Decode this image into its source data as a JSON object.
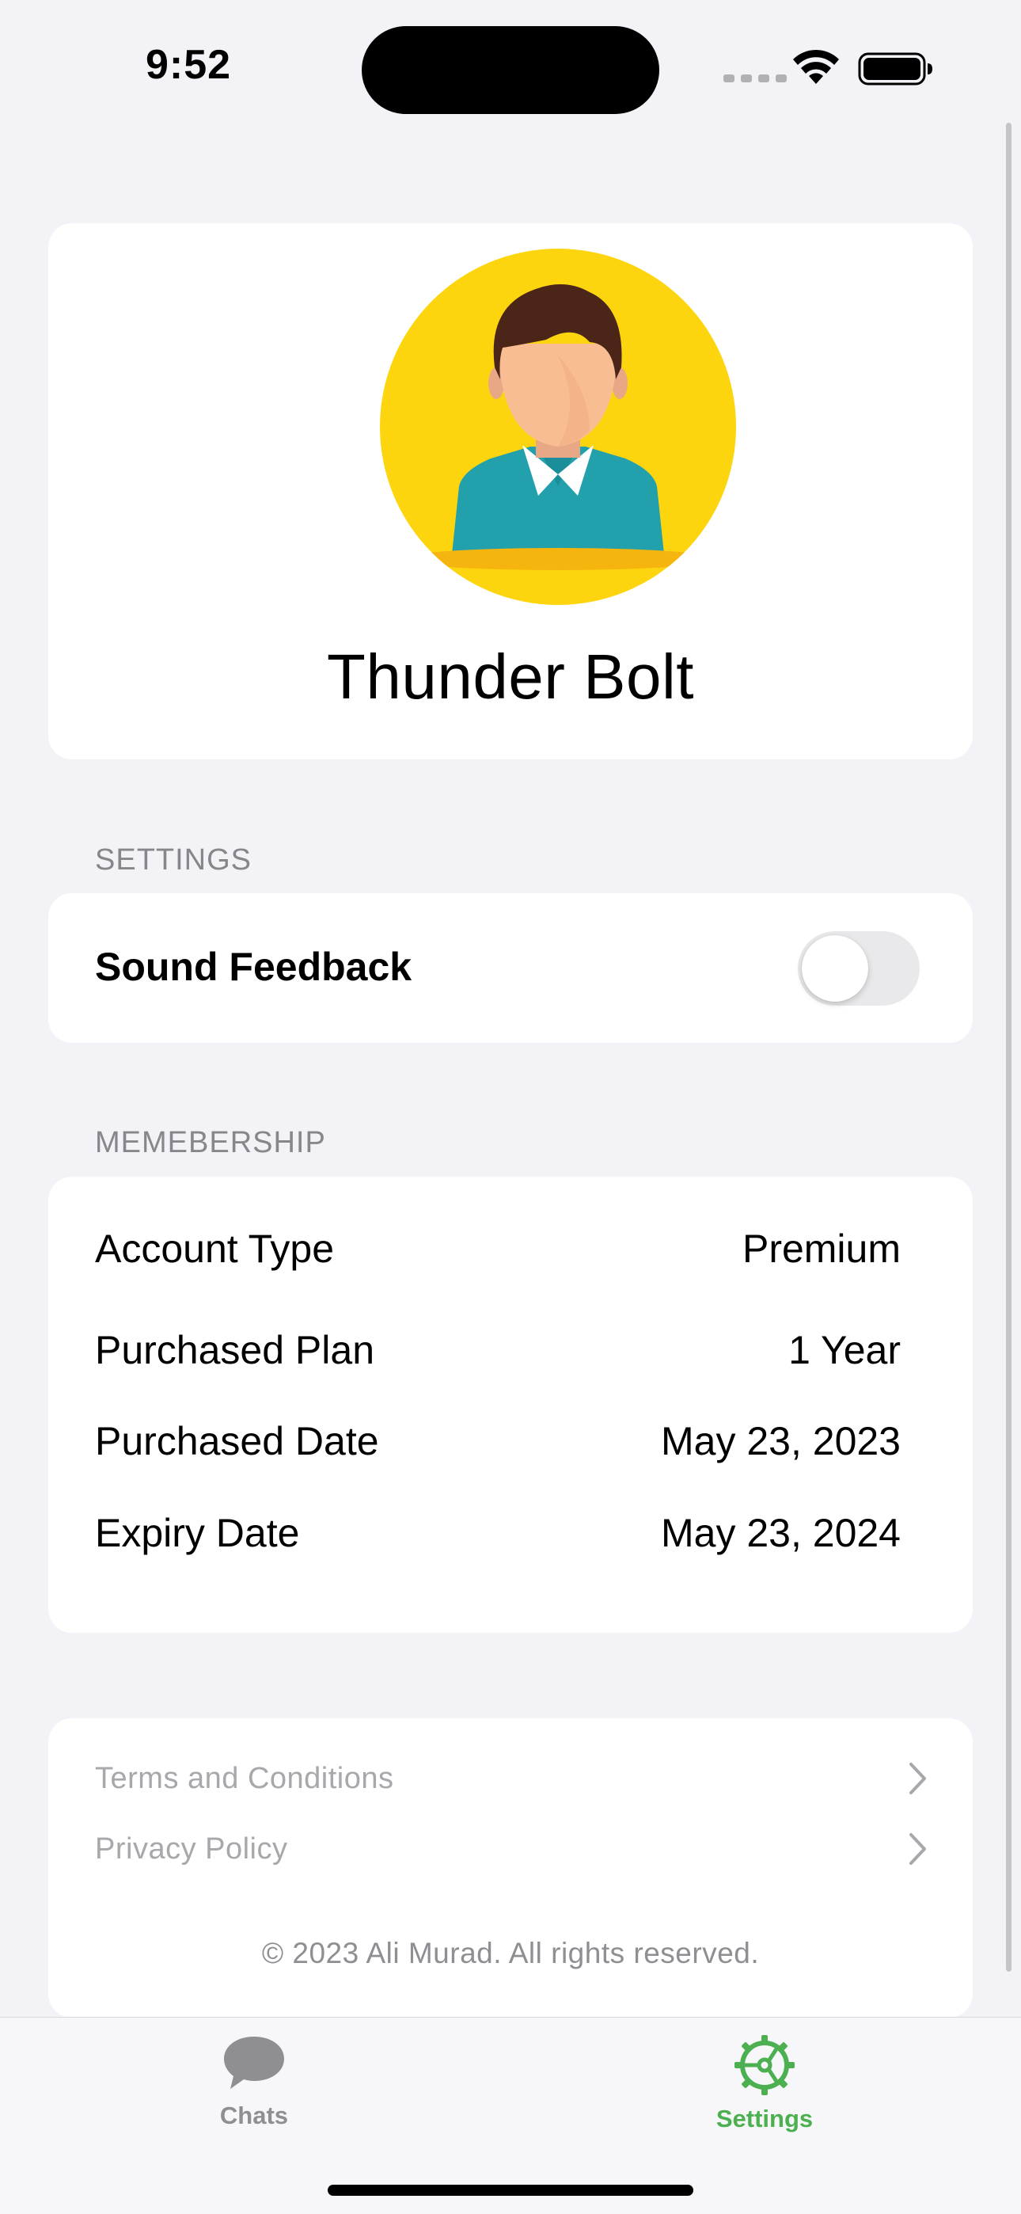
{
  "status_bar": {
    "time": "9:52"
  },
  "profile": {
    "name": "Thunder Bolt"
  },
  "settings_section": {
    "header": "SETTINGS",
    "sound_feedback_label": "Sound Feedback",
    "sound_feedback_enabled": false
  },
  "membership_section": {
    "header": "MEMEBERSHIP",
    "rows": [
      {
        "label": "Account Type",
        "value": "Premium"
      },
      {
        "label": "Purchased Plan",
        "value": "1 Year"
      },
      {
        "label": "Purchased Date",
        "value": "May 23, 2023"
      },
      {
        "label": "Expiry Date",
        "value": "May 23, 2024"
      }
    ]
  },
  "links": [
    {
      "label": "Terms and Conditions",
      "icon": "chevron-right-icon"
    },
    {
      "label": "Privacy Policy",
      "icon": "chevron-right-icon"
    }
  ],
  "copyright": "© 2023 Ali Murad. All rights reserved.",
  "tab_bar": {
    "tabs": [
      {
        "label": "Chats",
        "icon": "chat-bubble-icon",
        "selected": false
      },
      {
        "label": "Settings",
        "icon": "steering-wheel-gear-icon",
        "selected": true
      }
    ],
    "accent_color": "#4cb050"
  },
  "colors": {
    "avatar_background": "#fdd50f",
    "shirt": "#22a0ac"
  }
}
